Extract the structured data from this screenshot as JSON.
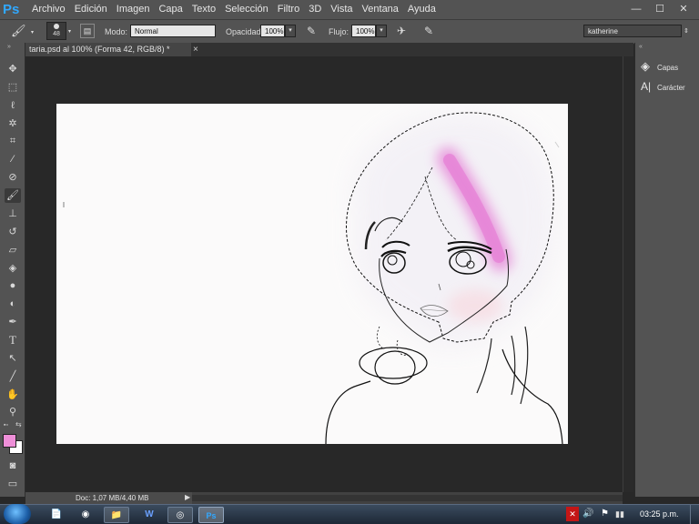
{
  "app": {
    "logo": "Ps",
    "menus": [
      "Archivo",
      "Edición",
      "Imagen",
      "Capa",
      "Texto",
      "Selección",
      "Filtro",
      "3D",
      "Vista",
      "Ventana",
      "Ayuda"
    ],
    "window_controls": {
      "minimize": "—",
      "maximize": "☐",
      "close": "✕"
    }
  },
  "options": {
    "brush_size": "48",
    "mode_label": "Modo:",
    "mode_value": "Normal",
    "opacity_label": "Opacidad:",
    "opacity_value": "100%",
    "flow_label": "Flujo:",
    "flow_value": "100%",
    "workspace": "katherine"
  },
  "document": {
    "tab_title": "taria.psd al 100% (Forma 42, RGB/8) *",
    "tab_close": "×",
    "status": "Doc: 1,07 MB/4,40 MB",
    "colors": {
      "foreground": "#ee8fd8",
      "background": "#ffffff",
      "highlight": "#e580d6"
    }
  },
  "panels": [
    {
      "name": "Capas",
      "icon": "layers-icon"
    },
    {
      "name": "Carácter",
      "icon": "character-icon"
    }
  ],
  "taskbar": {
    "clock": "03:25 p.m.",
    "apps": [
      "start-orb-icon",
      "file-icon",
      "chrome-icon",
      "folder-icon",
      "word-icon",
      "media-icon",
      "photoshop-icon"
    ]
  }
}
